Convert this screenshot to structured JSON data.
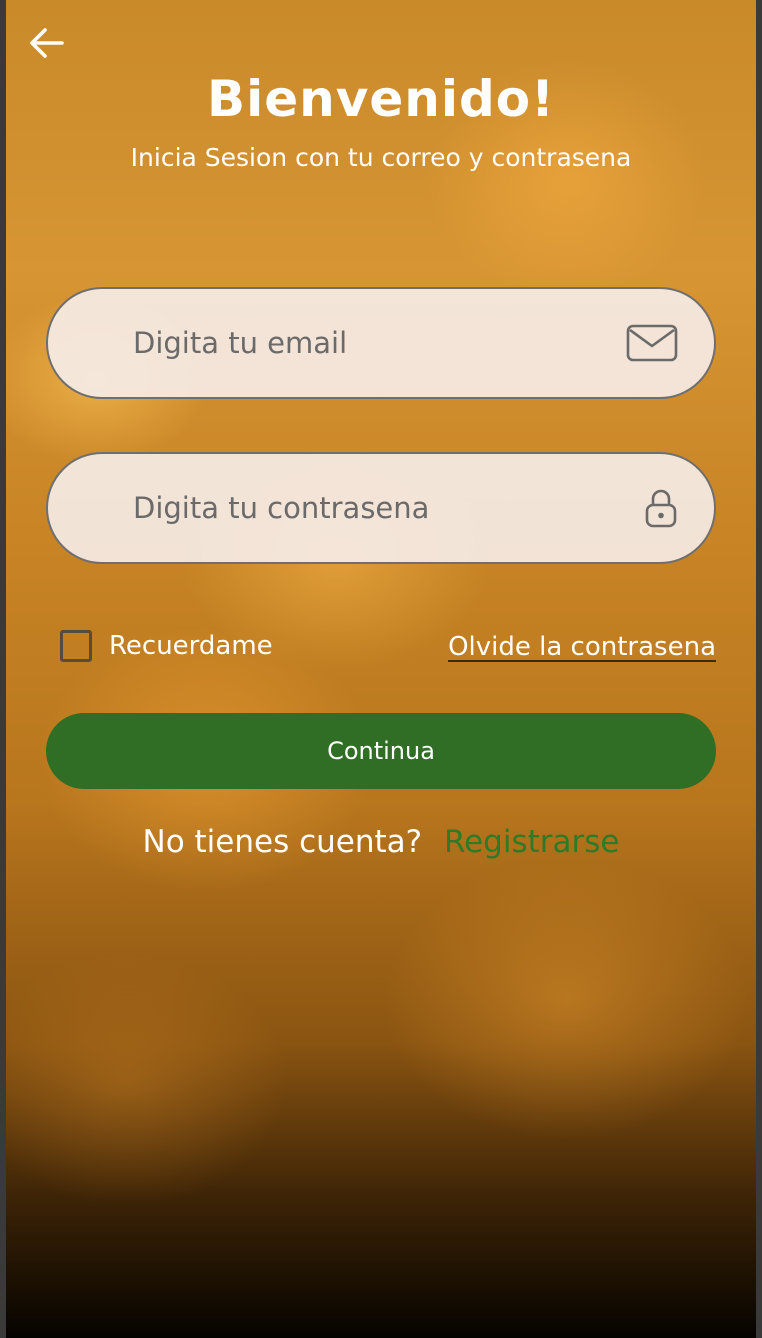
{
  "header": {
    "back_icon": "arrow-left-icon",
    "title": "Bienvenido!",
    "subtitle": "Inicia Sesion con tu correo y contrasena"
  },
  "form": {
    "email_placeholder": "Digita tu email",
    "email_value": "",
    "email_icon": "envelope-icon",
    "password_placeholder": "Digita tu contrasena",
    "password_value": "",
    "password_icon": "lock-icon",
    "remember_label": "Recuerdame",
    "remember_checked": false,
    "forgot_label": "Olvide la contrasena",
    "submit_label": "Continua"
  },
  "signup": {
    "prompt": "No tienes cuenta?",
    "link_label": "Registrarse"
  },
  "colors": {
    "primary_green": "#2f6e24",
    "link_green": "#2f7a28",
    "field_background": "#f5ebe6"
  }
}
